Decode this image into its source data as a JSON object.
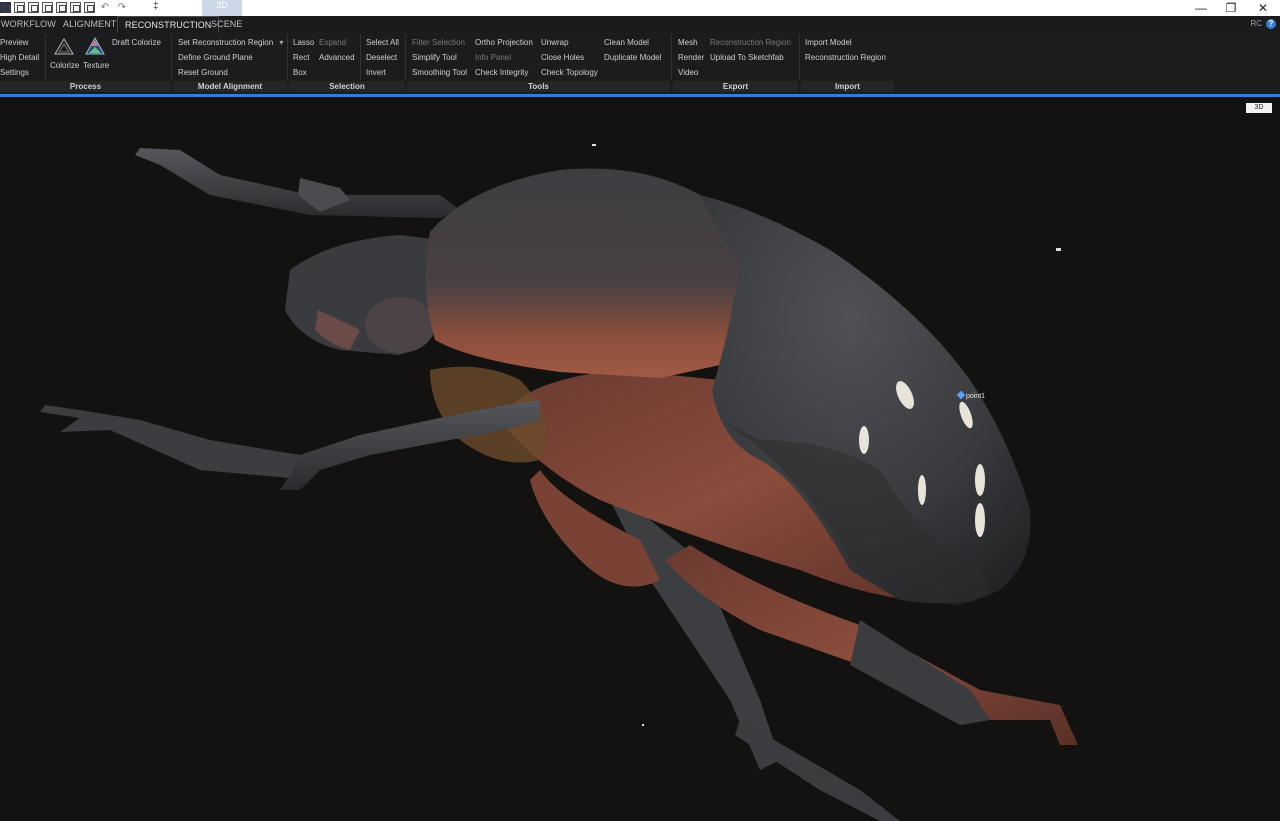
{
  "quick_access": {
    "icons": [
      "layout-1-icon",
      "layout-2-icon",
      "layout-3-icon",
      "layout-4-icon",
      "layout-5-icon",
      "layout-6-icon",
      "layout-7-icon"
    ],
    "undo_symbol": "↶",
    "redo_symbol": "↷",
    "doc_marker": "‡",
    "active_tab_badge": "3D"
  },
  "window_controls": {
    "minimize": "—",
    "restore": "❐",
    "close": "✕"
  },
  "menu_tabs": [
    "WORKFLOW",
    "ALIGNMENT",
    "RECONSTRUCTION",
    "SCENE"
  ],
  "active_tab": "RECONSTRUCTION",
  "rc_label": "RC",
  "help_symbol": "?",
  "ribbon": {
    "process": {
      "footer": "Process",
      "preview": "Preview",
      "high_detail": "High Detail",
      "settings": "Settings",
      "colorize": "Colorize",
      "texture": "Texture",
      "draft_colorize": "Draft Colorize"
    },
    "model_alignment": {
      "footer": "Model Alignment",
      "set_region": "Set Reconstruction Region",
      "define_ground": "Define Ground Plane",
      "reset_ground": "Reset Ground"
    },
    "selection": {
      "footer": "Selection",
      "lasso": "Lasso",
      "expand": "Expand",
      "rect": "Rect",
      "advanced": "Advanced",
      "box": "Box",
      "select_all": "Select All",
      "deselect": "Deselect",
      "invert": "Invert"
    },
    "tools": {
      "footer": "Tools",
      "filter_selection": "Filter Selection",
      "simplify_tool": "Simplify Tool",
      "smoothing_tool": "Smoothing Tool",
      "ortho_projection": "Ortho Projection",
      "info_panel": "Info Panel",
      "check_integrity": "Check Integrity",
      "unwrap": "Unwrap",
      "close_holes": "Close Holes",
      "check_topology": "Check Topology",
      "clean_model": "Clean Model",
      "duplicate_model": "Duplicate Model"
    },
    "export": {
      "footer": "Export",
      "mesh": "Mesh",
      "render": "Render",
      "video": "Video",
      "reconstruction_region": "Reconstruction Region",
      "upload_sketchfab": "Upload To Sketchfab"
    },
    "import": {
      "footer": "Import",
      "import_model": "Import Model",
      "reconstruction_region": "Reconstruction Region"
    }
  },
  "viewport": {
    "view_badge": "3D",
    "point_label": "point1",
    "colors": {
      "background": "#141211",
      "shell_dark": "#3c3c40",
      "shell_red": "#8a4a3a",
      "leg": "#3a3c40",
      "accent": "#2f7fd6"
    }
  }
}
